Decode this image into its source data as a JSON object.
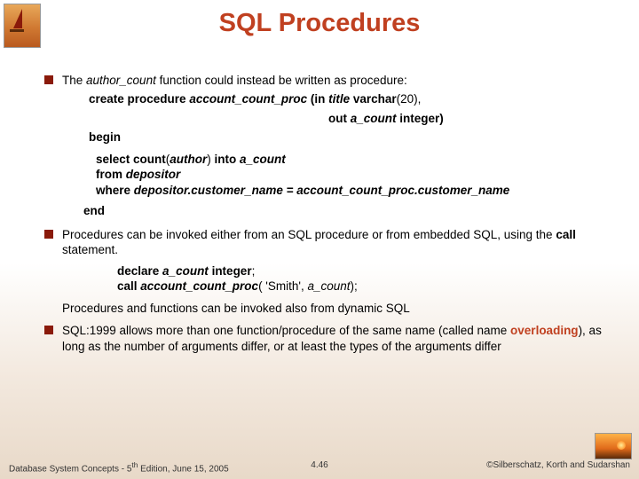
{
  "title": "SQL Procedures",
  "bullet1": {
    "intro_pre": "The ",
    "intro_func": "author_count",
    "intro_post": " function could instead be written as procedure:",
    "l1a": "create procedure ",
    "l1b": "account_count_proc ",
    "l1c": "(in ",
    "l1d": "title ",
    "l1e": "varchar",
    "l1f": "(20),",
    "l2a": "out ",
    "l2b": "a_count ",
    "l2c": "integer)",
    "begin": "begin",
    "s1a": "select count",
    "s1b": "(",
    "s1c": "author",
    "s1d": ") ",
    "s1e": "into ",
    "s1f": "a_count",
    "s2a": "from ",
    "s2b": "depositor",
    "s3a": "where ",
    "s3b": "depositor.customer_name = account_count_proc.customer_name",
    "end": "end"
  },
  "bullet2": {
    "p1": "Procedures can be invoked either from an SQL procedure or from embedded SQL, using the ",
    "p1b": "call ",
    "p1c": "statement.",
    "d1a": "declare ",
    "d1b": "a_count ",
    "d1c": "integer",
    "d1d": ";",
    "d2a": "call ",
    "d2b": "account_count_proc",
    "d2c": "( 'Smith', ",
    "d2d": "a_count",
    "d2e": ");",
    "p2": "Procedures and functions can be invoked also from dynamic SQL"
  },
  "bullet3": {
    "t1": "SQL:1999 allows more than one function/procedure of the same name (called name ",
    "t2": "overloading",
    "t3": "), as long as the number of arguments differ, or at least the types of the arguments differ"
  },
  "footer": {
    "left_a": "Database System Concepts - 5",
    "left_sup": "th",
    "left_b": " Edition,  June 15, 2005",
    "mid": "4.46",
    "right": "©Silberschatz, Korth and Sudarshan"
  }
}
